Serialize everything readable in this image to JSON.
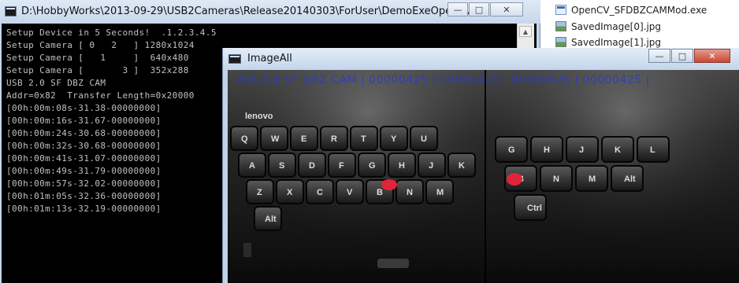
{
  "explorer": {
    "files": [
      {
        "name": "OpenCV_SFDBZCAMMod.exe",
        "icon": "exe-file-icon"
      },
      {
        "name": "SavedImage[0].jpg",
        "icon": "image-file-icon"
      },
      {
        "name": "SavedImage[1].jpg",
        "icon": "image-file-icon"
      }
    ]
  },
  "console": {
    "title": "D:\\HobbyWorks\\2013-09-29\\USB2Cameras\\Release20140303\\ForUser\\DemoExeOpenCv\\...",
    "buttons": {
      "minimize": "—",
      "maximize": "□",
      "close": "✕"
    },
    "lines": [
      "Setup Device in 5 Seconds!  .1.2.3.4.5",
      "Setup Camera [ 0   2   ] 1280x1024",
      "Setup Camera [   1     ]  640x480",
      "Setup Camera [       3 ]  352x288",
      "USB 2.0 SF DBZ CAM",
      "Addr=0x82  Transfer Length=0x20000",
      "[00h:00m:08s-31.38-00000000]",
      "[00h:00m:16s-31.67-00000000]",
      "[00h:00m:24s-30.68-00000000]",
      "[00h:00m:32s-30.68-00000000]",
      "[00h:00m:41s-31.07-00000000]",
      "[00h:00m:49s-31.79-00000000]",
      "[00h:00m:57s-32.02-00000000]",
      "[00h:01m:05s-32.36-00000000]",
      "[00h:01m:13s-32.19-00000000]"
    ],
    "scroll_up": "▲"
  },
  "image_window": {
    "title": "ImageAll",
    "buttons": {
      "minimize": "—",
      "maximize": "□",
      "close": "✕"
    },
    "overlay_text": "USB 2.0 SF DBZ CAM | 00000425 | 00000425 | 00000425 | 00000425 |",
    "left_keys": [
      "Q",
      "W",
      "E",
      "R",
      "T",
      "Y",
      "U",
      "A",
      "S",
      "D",
      "F",
      "G",
      "H",
      "J",
      "K",
      "Z",
      "X",
      "C",
      "V",
      "B",
      "N",
      "M",
      "Alt"
    ],
    "right_keys": [
      "G",
      "H",
      "J",
      "K",
      "L",
      "B",
      "N",
      "M",
      "Alt",
      "Ctrl"
    ],
    "brand": "lenovo"
  },
  "colors": {
    "terminal_bg": "#000000",
    "terminal_text": "#c0c0c0",
    "overlay_text": "#2b3cc2",
    "trackpoint": "#e0243a",
    "chrome": "#c4d5ea"
  }
}
